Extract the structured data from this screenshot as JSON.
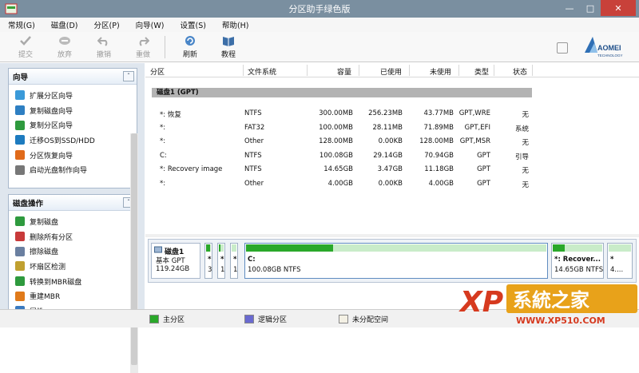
{
  "window": {
    "title": "分区助手绿色版"
  },
  "menu": [
    "常规(G)",
    "磁盘(D)",
    "分区(P)",
    "向导(W)",
    "设置(S)",
    "帮助(H)"
  ],
  "toolbar": {
    "commit": "提交",
    "discard": "放弃",
    "undo": "撤销",
    "redo": "重做",
    "refresh": "刷新",
    "tutorial": "教程"
  },
  "brand": {
    "name": "AOMEI",
    "sub": "TECHNOLOGY"
  },
  "wizard_panel": {
    "title": "向导",
    "items": [
      "扩展分区向导",
      "复制磁盘向导",
      "复制分区向导",
      "迁移OS到SSD/HDD",
      "分区恢复向导",
      "启动光盘制作向导"
    ]
  },
  "disk_ops_panel": {
    "title": "磁盘操作",
    "items": [
      "复制磁盘",
      "删除所有分区",
      "擦除磁盘",
      "坏扇区检测",
      "转换到MBR磁盘",
      "重建MBR",
      "属性"
    ]
  },
  "table": {
    "headers": [
      "分区",
      "文件系统",
      "容量",
      "已使用",
      "未使用",
      "类型",
      "状态"
    ],
    "disk_label": "磁盘1 (GPT)",
    "rows": [
      [
        "*: 恢复",
        "NTFS",
        "300.00MB",
        "256.23MB",
        "43.77MB",
        "GPT,WRE",
        "无"
      ],
      [
        "*:",
        "FAT32",
        "100.00MB",
        "28.11MB",
        "71.89MB",
        "GPT,EFI",
        "系统"
      ],
      [
        "*:",
        "Other",
        "128.00MB",
        "0.00KB",
        "128.00MB",
        "GPT,MSR",
        "无"
      ],
      [
        "C:",
        "NTFS",
        "100.08GB",
        "29.14GB",
        "70.94GB",
        "GPT",
        "引导"
      ],
      [
        "*: Recovery image",
        "NTFS",
        "14.65GB",
        "3.47GB",
        "11.18GB",
        "GPT",
        "无"
      ],
      [
        "*:",
        "Other",
        "4.00GB",
        "0.00KB",
        "4.00GB",
        "GPT",
        "无"
      ]
    ]
  },
  "disk_map": {
    "disk_name": "磁盘1",
    "disk_type": "基本 GPT",
    "disk_size": "119.24GB",
    "parts": [
      {
        "l1": "*",
        "l2": "3",
        "used": 0.85
      },
      {
        "l1": "*",
        "l2": "1",
        "used": 0.28
      },
      {
        "l1": "*",
        "l2": "1",
        "used": 0.0
      },
      {
        "l1": "C:",
        "l2": "100.08GB NTFS",
        "used": 0.29
      },
      {
        "l1": "*: Recover...",
        "l2": "14.65GB NTFS",
        "used": 0.24
      },
      {
        "l1": "*",
        "l2": "4....",
        "used": 0.0
      }
    ]
  },
  "legend": {
    "primary": "主分区",
    "logical": "逻辑分区",
    "unallocated": "未分配空间"
  },
  "colors": {
    "primary": "#2aa82a",
    "logical": "#6a6ad0",
    "unallocated": "#f3f0e4"
  },
  "watermark": {
    "text": "系統之家",
    "url": "WWW.XP510.COM"
  }
}
